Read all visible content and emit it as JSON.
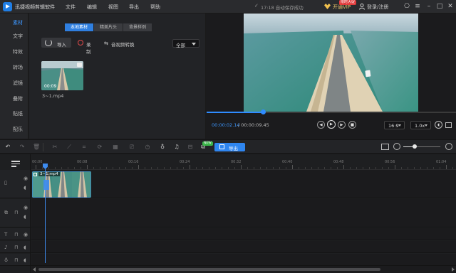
{
  "app": {
    "title": "迅捷视频剪辑软件",
    "menu": [
      "文件",
      "编辑",
      "视图",
      "导出",
      "帮助"
    ],
    "save_status": "17:18 自动保存成功",
    "vip_label": "开通VIP",
    "vip_promo": "限时大促",
    "login_label": "登录/注册"
  },
  "nav": {
    "items": [
      {
        "label": "素材",
        "active": true
      },
      {
        "label": "文字",
        "active": false
      },
      {
        "label": "特效",
        "active": false
      },
      {
        "label": "转场",
        "active": false
      },
      {
        "label": "滤镜",
        "active": false
      },
      {
        "label": "叠附",
        "active": false
      },
      {
        "label": "贴纸",
        "active": false
      },
      {
        "label": "配乐",
        "active": false
      }
    ]
  },
  "media": {
    "tabs": [
      {
        "label": "本地素材",
        "active": true
      },
      {
        "label": "精美片头",
        "active": false
      },
      {
        "label": "背景样例",
        "active": false
      }
    ],
    "import_label": "导入",
    "record_label": "录制",
    "convert_label": "音视频转换",
    "filter_value": "全部",
    "item": {
      "duration": "00:09",
      "name": "3~1.mp4"
    }
  },
  "preview": {
    "time_current": "00:00:02.14",
    "time_total": "/ 00:00:09.45",
    "progress": 0.226,
    "aspect_ratio": "16:9",
    "speed": "1.0x"
  },
  "toolbar": {
    "new_badge": "NEW",
    "export_label": "导出",
    "zoom_level": 0.3
  },
  "timeline": {
    "ruler_labels": [
      "00:00",
      "00:08",
      "00:16",
      "00:24",
      "00:32",
      "00:40",
      "00:48",
      "00:56",
      "01:04"
    ],
    "clip_name": "3~1.mp4"
  },
  "colors": {
    "accent": "#2f86f0",
    "active_text": "#3d97ff",
    "vip_gold": "#e7c46a",
    "promo_red": "#e23b3b",
    "new_green": "#3bb54a"
  }
}
